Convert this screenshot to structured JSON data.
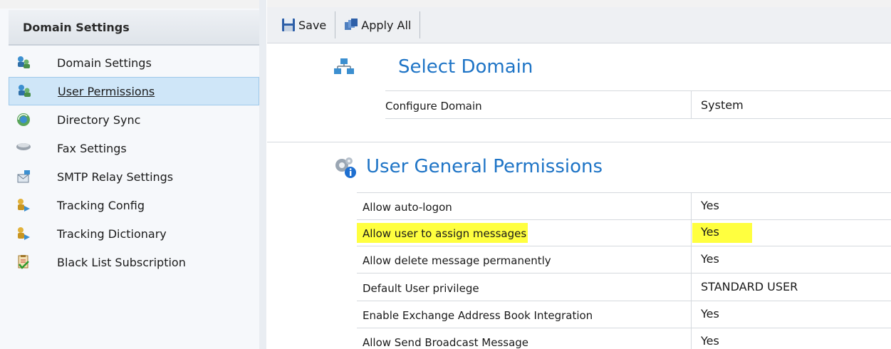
{
  "sidebar": {
    "header": "Domain Settings",
    "items": [
      {
        "label": "Domain Settings",
        "icon": "users-domain-icon"
      },
      {
        "label": "User Permissions",
        "icon": "user-permissions-icon"
      },
      {
        "label": "Directory Sync",
        "icon": "directory-sync-icon"
      },
      {
        "label": "Fax Settings",
        "icon": "fax-icon"
      },
      {
        "label": "SMTP Relay Settings",
        "icon": "smtp-relay-icon"
      },
      {
        "label": "Tracking Config",
        "icon": "tracking-icon"
      },
      {
        "label": "Tracking Dictionary",
        "icon": "tracking-dictionary-icon"
      },
      {
        "label": "Black List Subscription",
        "icon": "blacklist-icon"
      }
    ],
    "active_index": 1
  },
  "toolbar": {
    "save_label": "Save",
    "apply_all_label": "Apply All"
  },
  "select_domain": {
    "title": "Select Domain",
    "configure_label": "Configure Domain",
    "configure_value": "System"
  },
  "permissions": {
    "title": "User General Permissions",
    "rows": [
      {
        "label": "Allow auto-logon",
        "value": "Yes"
      },
      {
        "label": "Allow user to assign messages",
        "value": "Yes"
      },
      {
        "label": "Allow delete message permanently",
        "value": "Yes"
      },
      {
        "label": "Default User privilege",
        "value": "STANDARD USER"
      },
      {
        "label": "Enable Exchange Address Book Integration",
        "value": "Yes"
      },
      {
        "label": "Allow Send Broadcast Message",
        "value": "Yes"
      }
    ]
  },
  "colors": {
    "accent": "#1e74c6",
    "highlight": "#ffff3f",
    "active_item_bg": "#cfe6f8"
  }
}
